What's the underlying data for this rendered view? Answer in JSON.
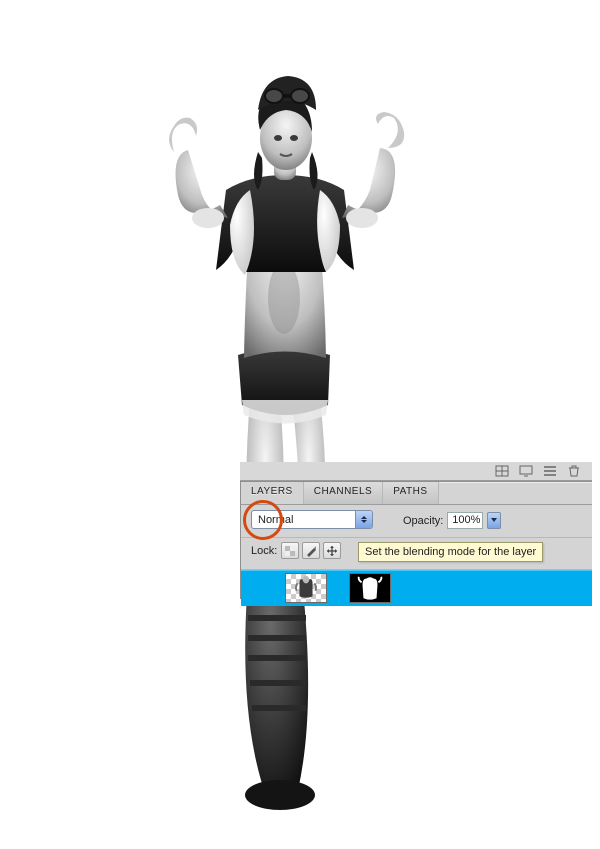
{
  "panel": {
    "tabs": [
      "LAYERS",
      "CHANNELS",
      "PATHS"
    ],
    "active_tab_index": 0,
    "blend_mode": "Normal",
    "opacity_label": "Opacity:",
    "opacity_value": "100%",
    "lock_label": "Lock:",
    "tooltip": "Set the blending mode for the layer"
  },
  "top_icons": {
    "guide": "guide-icon",
    "screen": "screen-icon",
    "menu": "menu-icon",
    "trash": "trash-icon"
  }
}
